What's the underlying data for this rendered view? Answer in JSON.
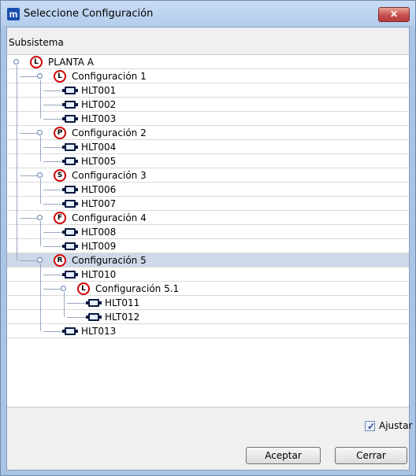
{
  "window": {
    "title": "Seleccione Configuración",
    "app_icon_letter": "m",
    "close_symbol": "✕"
  },
  "header": {
    "column_label": "Subsistema"
  },
  "tree": [
    {
      "label": "PLANTA A",
      "badge": "L",
      "kind": "config",
      "level": 0
    },
    {
      "label": "Configuración 1",
      "badge": "L",
      "kind": "config",
      "level": 1
    },
    {
      "label": "HLT001",
      "kind": "device",
      "level": 2
    },
    {
      "label": "HLT002",
      "kind": "device",
      "level": 2
    },
    {
      "label": "HLT003",
      "kind": "device",
      "level": 2
    },
    {
      "label": "Configuración 2",
      "badge": "P",
      "kind": "config",
      "level": 1
    },
    {
      "label": "HLT004",
      "kind": "device",
      "level": 2
    },
    {
      "label": "HLT005",
      "kind": "device",
      "level": 2
    },
    {
      "label": "Configuración 3",
      "badge": "S",
      "kind": "config",
      "level": 1
    },
    {
      "label": "HLT006",
      "kind": "device",
      "level": 2
    },
    {
      "label": "HLT007",
      "kind": "device",
      "level": 2
    },
    {
      "label": "Configuración 4",
      "badge": "F",
      "kind": "config",
      "level": 1
    },
    {
      "label": "HLT008",
      "kind": "device",
      "level": 2
    },
    {
      "label": "HLT009",
      "kind": "device",
      "level": 2
    },
    {
      "label": "Configuración 5",
      "badge": "R",
      "kind": "config",
      "level": 1,
      "selected": true
    },
    {
      "label": "HLT010",
      "kind": "device",
      "level": 2
    },
    {
      "label": "Configuración 5.1",
      "badge": "L",
      "kind": "config",
      "level": 2
    },
    {
      "label": "HLT011",
      "kind": "device",
      "level": 3
    },
    {
      "label": "HLT012",
      "kind": "device",
      "level": 3
    },
    {
      "label": "HLT013",
      "kind": "device",
      "level": 2
    }
  ],
  "options": {
    "ajustar_label": "Ajustar",
    "ajustar_checked": true,
    "check_mark": "✓"
  },
  "buttons": {
    "ok_label": "Aceptar",
    "close_label": "Cerrar"
  },
  "colors": {
    "badge_ring": "#d00000",
    "selection": "#cfd8e8",
    "device_icon": "#0a1a40"
  }
}
